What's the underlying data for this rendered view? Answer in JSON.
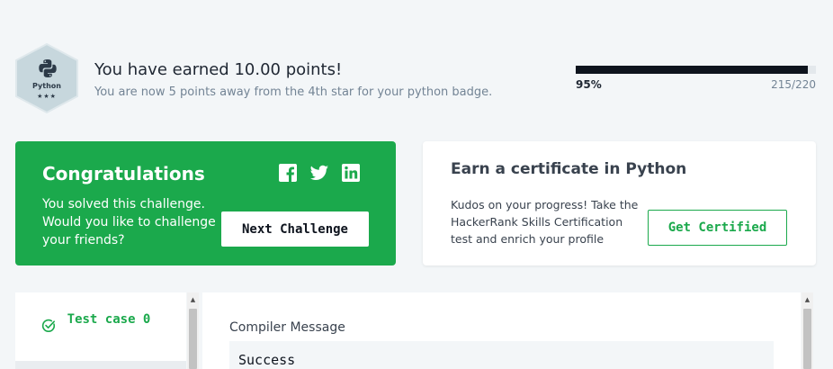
{
  "badge": {
    "name": "Python",
    "stars": "★★★",
    "icon": "python-logo-icon"
  },
  "earned": {
    "title": "You have earned 10.00 points!",
    "subtitle": "You are now 5 points away from the 4th star for your python badge."
  },
  "progress": {
    "percent_label": "95%",
    "count_label": "215/220",
    "fraction": 0.966
  },
  "congrats": {
    "title": "Congratulations",
    "text": "You solved this challenge. Would you like to challenge your friends?",
    "next_label": "Next Challenge",
    "social_icons": [
      "facebook-icon",
      "twitter-icon",
      "linkedin-icon"
    ]
  },
  "certificate": {
    "title": "Earn a certificate in Python",
    "text": "Kudos on your progress! Take the HackerRank Skills Certification test and enrich your profile",
    "button_label": "Get Certified"
  },
  "test_case": {
    "label": "Test case 0",
    "status_icon": "check-circle-icon"
  },
  "compiler": {
    "label": "Compiler Message",
    "value": "Success"
  },
  "colors": {
    "accent_green": "#1ba94c",
    "dark": "#0e141e",
    "background": "#f3f6f8"
  }
}
